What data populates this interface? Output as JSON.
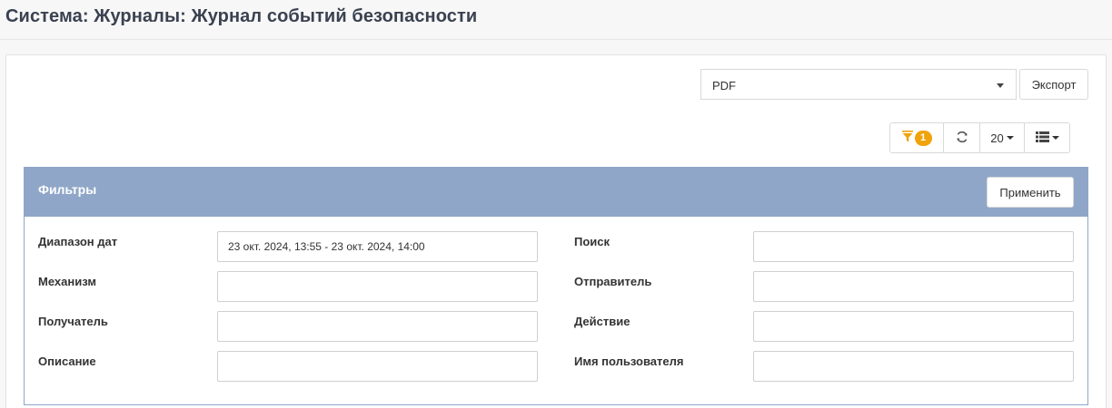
{
  "page": {
    "title": "Система: Журналы: Журнал событий безопасности"
  },
  "export": {
    "format_value": "PDF",
    "export_label": "Экспорт"
  },
  "toolbar": {
    "filter_count": "1",
    "page_size": "20"
  },
  "filters": {
    "title": "Фильтры",
    "apply_label": "Применить",
    "fields": [
      {
        "label": "Диапазон дат",
        "value": "23 окт. 2024, 13:55 - 23 окт. 2024, 14:00"
      },
      {
        "label": "Поиск",
        "value": ""
      },
      {
        "label": "Механизм",
        "value": ""
      },
      {
        "label": "Отправитель",
        "value": ""
      },
      {
        "label": "Получатель",
        "value": ""
      },
      {
        "label": "Действие",
        "value": ""
      },
      {
        "label": "Описание",
        "value": ""
      },
      {
        "label": "Имя пользователя",
        "value": ""
      }
    ]
  },
  "colors": {
    "filters_header": "#8fa6c8",
    "badge": "#f0a30a"
  },
  "icons": [
    "filter-icon",
    "refresh-icon",
    "columns-list-icon",
    "chevron-down-icon"
  ]
}
